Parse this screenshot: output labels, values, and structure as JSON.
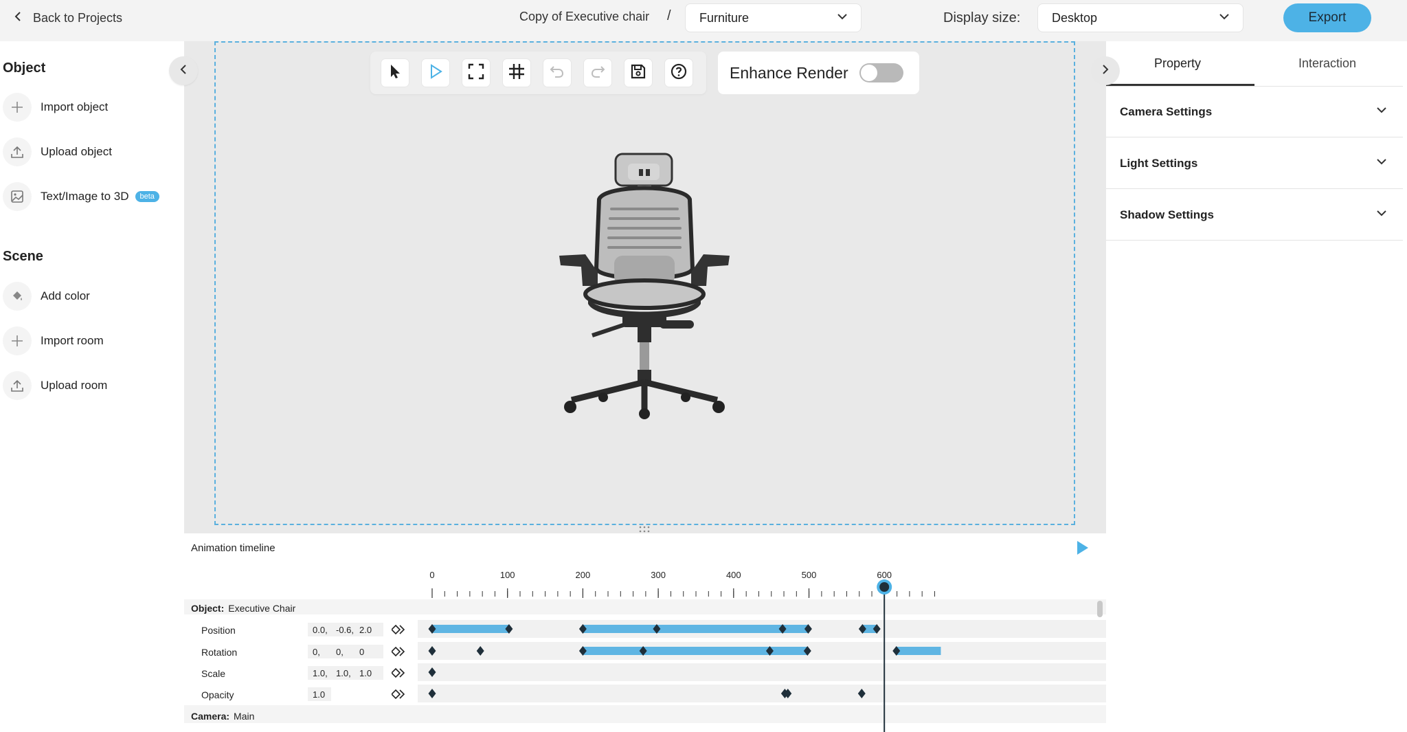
{
  "topbar": {
    "back_label": "Back to Projects",
    "project_name": "Copy of Executive chair",
    "separator": "/",
    "category": "Furniture",
    "display_label": "Display size:",
    "display_value": "Desktop",
    "export_label": "Export"
  },
  "sidebar": {
    "object_title": "Object",
    "object_items": [
      {
        "label": "Import object",
        "icon": "plus-icon"
      },
      {
        "label": "Upload object",
        "icon": "upload-icon"
      },
      {
        "label": "Text/Image to 3D",
        "icon": "image-icon",
        "badge": "beta"
      }
    ],
    "scene_title": "Scene",
    "scene_items": [
      {
        "label": "Add color",
        "icon": "paint-bucket-icon"
      },
      {
        "label": "Import room",
        "icon": "plus-icon"
      },
      {
        "label": "Upload room",
        "icon": "upload-icon"
      }
    ]
  },
  "toolbar": {
    "tools": [
      "select-cursor-icon",
      "play-icon",
      "fullscreen-icon",
      "grid-icon",
      "undo-icon",
      "redo-icon",
      "save-icon",
      "help-icon"
    ],
    "enhance_label": "Enhance Render",
    "enhance_on": false
  },
  "right_panel": {
    "tabs": [
      "Property",
      "Interaction"
    ],
    "active_tab": "Property",
    "sections": [
      "Camera Settings",
      "Light Settings",
      "Shadow Settings"
    ]
  },
  "timeline": {
    "title": "Animation timeline",
    "ticks": [
      "0",
      "100",
      "200",
      "300",
      "400",
      "500",
      "600"
    ],
    "playhead": 600,
    "object_group": {
      "prefix": "Object:",
      "name": "Executive Chair"
    },
    "camera_group": {
      "prefix": "Camera:",
      "name": "Main"
    },
    "tracks": [
      {
        "label": "Position",
        "values": [
          "0.0,",
          "-0.6,",
          "2.0"
        ],
        "keys": [
          0,
          102,
          200,
          298,
          465,
          499,
          571,
          590
        ],
        "bars": [
          [
            0,
            102
          ],
          [
            200,
            499
          ],
          [
            571,
            590
          ]
        ]
      },
      {
        "label": "Rotation",
        "values": [
          "0,",
          "0,",
          "0"
        ],
        "keys": [
          0,
          64,
          200,
          280,
          448,
          498,
          616
        ],
        "bars": [
          [
            200,
            498
          ],
          [
            616,
            675
          ]
        ]
      },
      {
        "label": "Scale",
        "values": [
          "1.0,",
          "1.0,",
          "1.0"
        ],
        "keys": [
          0
        ],
        "bars": []
      },
      {
        "label": "Opacity",
        "values": [
          "1.0"
        ],
        "keys": [
          0,
          468,
          472,
          570
        ],
        "bars": []
      }
    ],
    "colors": {
      "bar": "#5fb5e3",
      "key": "#1f2f3a",
      "accent": "#4db2e6"
    }
  }
}
